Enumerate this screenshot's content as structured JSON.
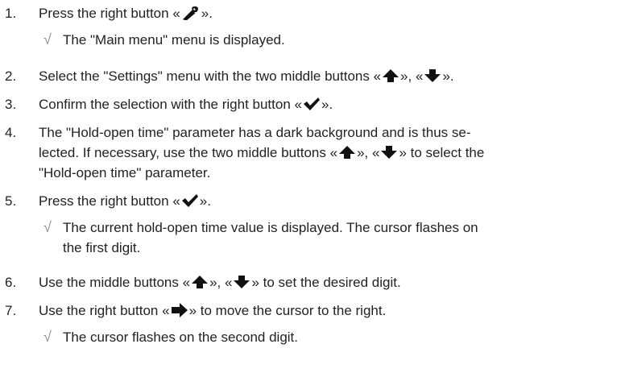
{
  "steps": [
    {
      "num": "1.",
      "before": "Press the right button ",
      "icon": "wrench-icon",
      "after": ".",
      "result": "The \"Main menu\" menu is displayed."
    },
    {
      "num": "2.",
      "before": "Select the \"Settings\" menu with the two middle buttons ",
      "icon1": "arrow-up-icon",
      "mid": ", ",
      "icon2": "arrow-down-icon",
      "after": "."
    },
    {
      "num": "3.",
      "before": "Confirm the selection with the right button ",
      "icon": "checkmark-icon",
      "after": "."
    },
    {
      "num": "4.",
      "line1": "The \"Hold-open time\" parameter has a dark background and is thus se-",
      "line2_before": "lected. If necessary, use the two middle buttons ",
      "icon1": "arrow-up-icon",
      "mid": ", ",
      "icon2": "arrow-down-icon",
      "line2_after": " to select the",
      "line3": "\"Hold-open time\" parameter."
    },
    {
      "num": "5.",
      "before": "Press the right button ",
      "icon": "checkmark-icon",
      "after": ".",
      "result_line1": "The current hold-open time value is displayed. The cursor flashes on",
      "result_line2": "the first digit."
    },
    {
      "num": "6.",
      "before": "Use the middle buttons ",
      "icon1": "arrow-up-icon",
      "mid": ", ",
      "icon2": "arrow-down-icon",
      "after": " to set the desired digit."
    },
    {
      "num": "7.",
      "before": "Use the right button ",
      "icon": "arrow-right-icon",
      "after": " to move the cursor to the right.",
      "result": "The cursor flashes on the second digit."
    }
  ],
  "result_mark": "√",
  "quote_open": "«",
  "quote_close": "»"
}
